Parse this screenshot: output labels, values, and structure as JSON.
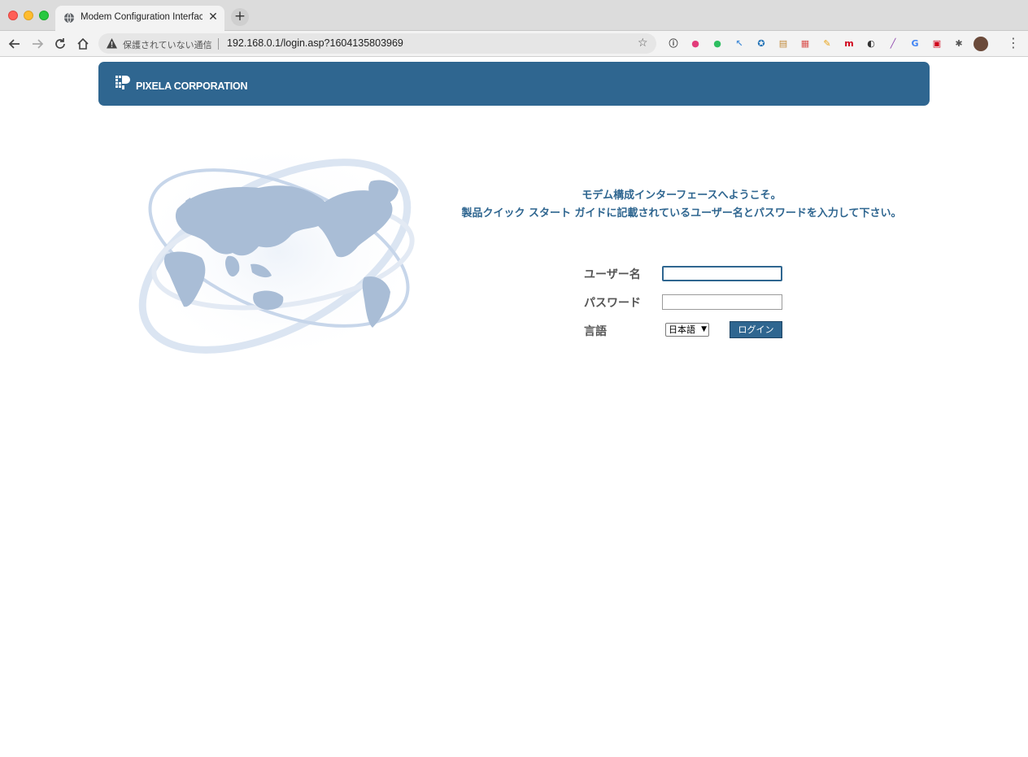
{
  "browser": {
    "tab_title": "Modem Configuration Interface",
    "tab_close": "✕",
    "new_tab": "+",
    "security_label": "保護されていない通信",
    "url": "192.168.0.1/login.asp?1604135803969",
    "menu": "⋮",
    "extensions": [
      {
        "name": "info-ext-icon",
        "glyph": "ⓘ",
        "color": "#444444"
      },
      {
        "name": "color-wheel-ext-icon",
        "glyph": "●",
        "color": "#e23c7a"
      },
      {
        "name": "evernote-ext-icon",
        "glyph": "●",
        "color": "#2dbe60"
      },
      {
        "name": "cursor-ext-icon",
        "glyph": "↖",
        "color": "#4a90d9"
      },
      {
        "name": "compass-ext-icon",
        "glyph": "✪",
        "color": "#1c6fb5"
      },
      {
        "name": "clipboard-ext-icon",
        "glyph": "▤",
        "color": "#c08a3a"
      },
      {
        "name": "calendar-ext-icon",
        "glyph": "▦",
        "color": "#d9534f"
      },
      {
        "name": "pencil-ext-icon",
        "glyph": "✎",
        "color": "#e8a317"
      },
      {
        "name": "m-ext-icon",
        "glyph": "m",
        "color": "#d0021b"
      },
      {
        "name": "speedometer-off-ext-icon",
        "glyph": "◐",
        "color": "#333333"
      },
      {
        "name": "pen-ext-icon",
        "glyph": "╱",
        "color": "#8e44ad"
      },
      {
        "name": "translate-ext-icon",
        "glyph": "G",
        "color": "#4285f4"
      },
      {
        "name": "window-ext-icon",
        "glyph": "▣",
        "color": "#d0021b"
      },
      {
        "name": "puzzle-ext-icon",
        "glyph": "✱",
        "color": "#555555"
      },
      {
        "name": "avatar-icon",
        "glyph": "●",
        "color": "#6b4a3a"
      }
    ]
  },
  "header": {
    "company": "PIXELA CORPORATION"
  },
  "welcome": {
    "line1": "モデム構成インターフェースへようこそ。",
    "line2": "製品クイック スタート ガイドに記載されているユーザー名とパスワードを入力して下さい。"
  },
  "form": {
    "username_label": "ユーザー名",
    "username_value": "",
    "password_label": "パスワード",
    "password_value": "",
    "language_label": "言語",
    "language_selected": "日本語",
    "login_button": "ログイン"
  }
}
